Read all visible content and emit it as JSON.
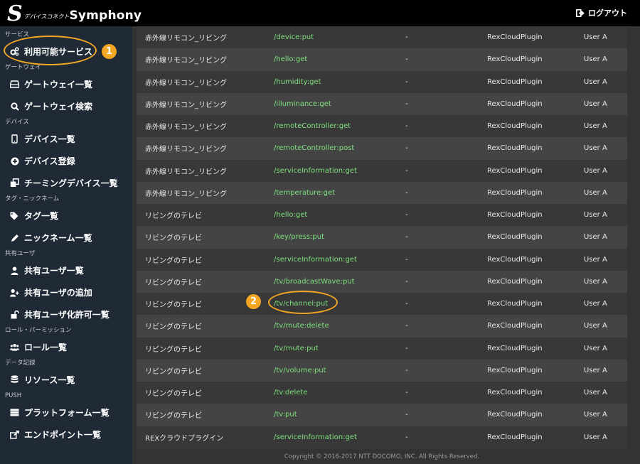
{
  "header": {
    "logo_mark": "S",
    "logo_sub": "デバイスコネクト",
    "logo_name": "Symphony",
    "logout_label": "ログアウト"
  },
  "sidebar": {
    "sections": [
      {
        "title": "サービス",
        "items": [
          {
            "label": "利用可能サービス",
            "icon": "services-icon"
          }
        ]
      },
      {
        "title": "ゲートウェイ",
        "items": [
          {
            "label": "ゲートウェイ一覧",
            "icon": "drive-icon"
          },
          {
            "label": "ゲートウェイ検索",
            "icon": "search-icon"
          }
        ]
      },
      {
        "title": "デバイス",
        "items": [
          {
            "label": "デバイス一覧",
            "icon": "mobile-icon"
          },
          {
            "label": "デバイス登録",
            "icon": "plus-circle-icon"
          },
          {
            "label": "チーミングデバイス一覧",
            "icon": "clone-icon"
          }
        ]
      },
      {
        "title": "タグ・ニックネーム",
        "items": [
          {
            "label": "タグ一覧",
            "icon": "tags-icon"
          },
          {
            "label": "ニックネーム一覧",
            "icon": "pencil-icon"
          }
        ]
      },
      {
        "title": "共有ユーザ",
        "items": [
          {
            "label": "共有ユーザ一覧",
            "icon": "user-icon"
          },
          {
            "label": "共有ユーザの追加",
            "icon": "user-plus-icon"
          },
          {
            "label": "共有ユーザ化許可一覧",
            "icon": "unlock-icon"
          }
        ]
      },
      {
        "title": "ロール・パーミッション",
        "items": [
          {
            "label": "ロール一覧",
            "icon": "users-icon"
          }
        ]
      },
      {
        "title": "データ記録",
        "items": [
          {
            "label": "リソース一覧",
            "icon": "database-icon"
          }
        ]
      },
      {
        "title": "PUSH",
        "items": [
          {
            "label": "プラットフォーム一覧",
            "icon": "server-icon"
          },
          {
            "label": "エンドポイント一覧",
            "icon": "share-icon"
          }
        ]
      }
    ]
  },
  "table": {
    "rows": [
      {
        "device": "赤外線リモコン_リビング",
        "api": "/device:put",
        "status": "-",
        "plugin": "RexCloudPlugin",
        "user": "User A"
      },
      {
        "device": "赤外線リモコン_リビング",
        "api": "/hello:get",
        "status": "-",
        "plugin": "RexCloudPlugin",
        "user": "User A"
      },
      {
        "device": "赤外線リモコン_リビング",
        "api": "/humidity:get",
        "status": "-",
        "plugin": "RexCloudPlugin",
        "user": "User A"
      },
      {
        "device": "赤外線リモコン_リビング",
        "api": "/illuminance:get",
        "status": "-",
        "plugin": "RexCloudPlugin",
        "user": "User A"
      },
      {
        "device": "赤外線リモコン_リビング",
        "api": "/remoteController:get",
        "status": "-",
        "plugin": "RexCloudPlugin",
        "user": "User A"
      },
      {
        "device": "赤外線リモコン_リビング",
        "api": "/remoteController:post",
        "status": "-",
        "plugin": "RexCloudPlugin",
        "user": "User A"
      },
      {
        "device": "赤外線リモコン_リビング",
        "api": "/serviceInformation:get",
        "status": "-",
        "plugin": "RexCloudPlugin",
        "user": "User A"
      },
      {
        "device": "赤外線リモコン_リビング",
        "api": "/temperature:get",
        "status": "-",
        "plugin": "RexCloudPlugin",
        "user": "User A"
      },
      {
        "device": "リビングのテレビ",
        "api": "/hello:get",
        "status": "-",
        "plugin": "RexCloudPlugin",
        "user": "User A"
      },
      {
        "device": "リビングのテレビ",
        "api": "/key/press:put",
        "status": "-",
        "plugin": "RexCloudPlugin",
        "user": "User A"
      },
      {
        "device": "リビングのテレビ",
        "api": "/serviceInformation:get",
        "status": "-",
        "plugin": "RexCloudPlugin",
        "user": "User A"
      },
      {
        "device": "リビングのテレビ",
        "api": "/tv/broadcastWave:put",
        "status": "-",
        "plugin": "RexCloudPlugin",
        "user": "User A"
      },
      {
        "device": "リビングのテレビ",
        "api": "/tv/channel:put",
        "status": "-",
        "plugin": "RexCloudPlugin",
        "user": "User A"
      },
      {
        "device": "リビングのテレビ",
        "api": "/tv/mute:delete",
        "status": "-",
        "plugin": "RexCloudPlugin",
        "user": "User A"
      },
      {
        "device": "リビングのテレビ",
        "api": "/tv/mute:put",
        "status": "-",
        "plugin": "RexCloudPlugin",
        "user": "User A"
      },
      {
        "device": "リビングのテレビ",
        "api": "/tv/volume:put",
        "status": "-",
        "plugin": "RexCloudPlugin",
        "user": "User A"
      },
      {
        "device": "リビングのテレビ",
        "api": "/tv:delete",
        "status": "-",
        "plugin": "RexCloudPlugin",
        "user": "User A"
      },
      {
        "device": "リビングのテレビ",
        "api": "/tv:put",
        "status": "-",
        "plugin": "RexCloudPlugin",
        "user": "User A"
      },
      {
        "device": "REXクラウドプラグイン",
        "api": "/serviceInformation:get",
        "status": "-",
        "plugin": "RexCloudPlugin",
        "user": "User A"
      }
    ]
  },
  "footer": {
    "text": "Copyright © 2016-2017 NTT DOCOMO, INC. All Rights Reserved."
  },
  "annotations": {
    "badge1": "1",
    "badge2": "2",
    "color": "#f5a623"
  },
  "colors": {
    "header_bg": "#000000",
    "sidebar_bg": "#1f2a36",
    "api_link": "#7fe07f"
  }
}
